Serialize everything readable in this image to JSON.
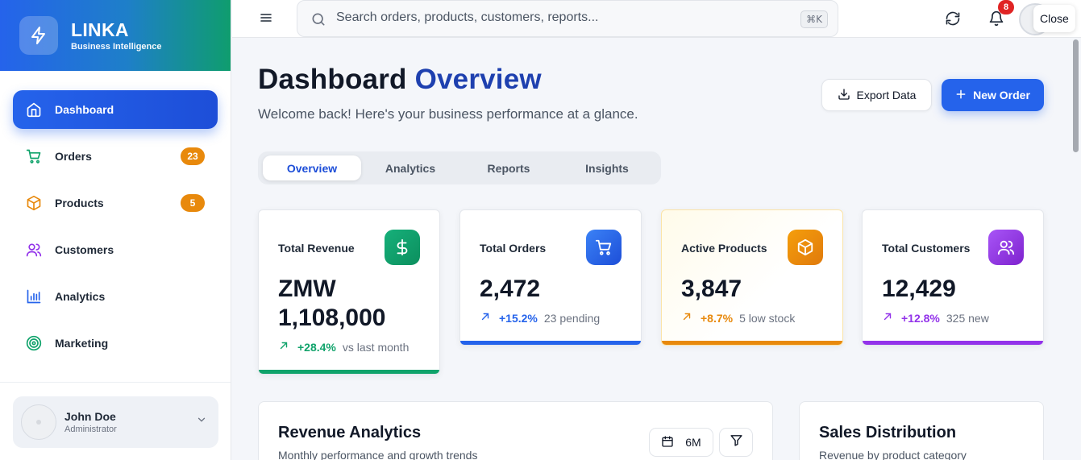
{
  "brand": {
    "name": "LINKA",
    "subtitle": "Business Intelligence"
  },
  "sidebar": {
    "items": [
      {
        "label": "Dashboard",
        "icon": "home-icon",
        "active": true
      },
      {
        "label": "Orders",
        "icon": "cart-icon",
        "badge": "23"
      },
      {
        "label": "Products",
        "icon": "box-icon",
        "badge": "5"
      },
      {
        "label": "Customers",
        "icon": "users-icon"
      },
      {
        "label": "Analytics",
        "icon": "bar-chart-icon"
      },
      {
        "label": "Marketing",
        "icon": "target-icon"
      }
    ],
    "user": {
      "name": "John Doe",
      "role": "Administrator"
    }
  },
  "topbar": {
    "search_placeholder": "Search orders, products, customers, reports...",
    "shortcut": "⌘K",
    "notifications_count": "8",
    "close_label": "Close"
  },
  "header": {
    "title_main": "Dashboard",
    "title_accent": "Overview",
    "subtitle": "Welcome back! Here's your business performance at a glance.",
    "export_label": "Export Data",
    "new_order_label": "New Order"
  },
  "tabs": [
    {
      "label": "Overview",
      "active": true
    },
    {
      "label": "Analytics"
    },
    {
      "label": "Reports"
    },
    {
      "label": "Insights"
    }
  ],
  "cards": [
    {
      "label": "Total Revenue",
      "value": "ZMW 1,108,000",
      "change": "+28.4%",
      "note": "vs last month",
      "icon": "dollar-icon",
      "color": "#10a36b"
    },
    {
      "label": "Total Orders",
      "value": "2,472",
      "change": "+15.2%",
      "note": "23 pending",
      "icon": "cart-icon",
      "color": "#2563eb"
    },
    {
      "label": "Active Products",
      "value": "3,847",
      "change": "+8.7%",
      "note": "5 low stock",
      "icon": "box-icon",
      "color": "#e8890c"
    },
    {
      "label": "Total Customers",
      "value": "12,429",
      "change": "+12.8%",
      "note": "325 new",
      "icon": "users-icon",
      "color": "#9333ea"
    }
  ],
  "revenue_panel": {
    "title": "Revenue Analytics",
    "subtitle": "Monthly performance and growth trends",
    "period": "6M"
  },
  "sales_panel": {
    "title": "Sales Distribution",
    "subtitle": "Revenue by product category"
  },
  "colors": {
    "primary": "#2563eb",
    "success": "#10a36b",
    "warning": "#e8890c",
    "purple": "#9333ea",
    "danger": "#e02424"
  }
}
